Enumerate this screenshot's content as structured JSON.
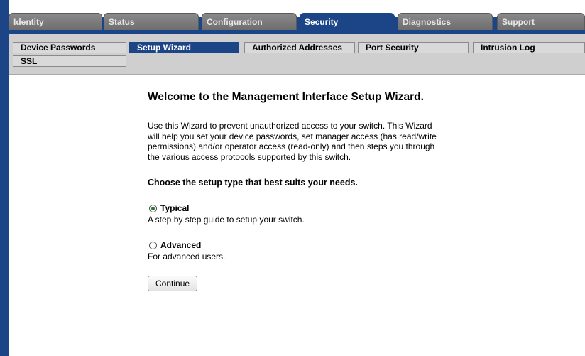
{
  "top_tabs": [
    {
      "label": "Identity",
      "active": false
    },
    {
      "label": "Status",
      "active": false
    },
    {
      "label": "Configuration",
      "active": false
    },
    {
      "label": "Security",
      "active": true
    },
    {
      "label": "Diagnostics",
      "active": false
    },
    {
      "label": "Support",
      "active": false
    }
  ],
  "sub_tabs": [
    {
      "label": "Device Passwords",
      "active": false
    },
    {
      "label": "Setup Wizard",
      "active": true
    },
    {
      "label": "Authorized Addresses",
      "active": false
    },
    {
      "label": "Port Security",
      "active": false
    },
    {
      "label": "Intrusion Log",
      "active": false
    },
    {
      "label": "SSL",
      "active": false
    }
  ],
  "main": {
    "title": "Welcome to the Management Interface Setup Wizard.",
    "description": "Use this Wizard to prevent unauthorized access to your switch. This Wizard will help you set your device passwords, set manager access (has read/write permissions) and/or operator access (read-only) and then steps you through the various access protocols supported by this switch.",
    "choose_label": "Choose the setup type that best suits your needs.",
    "options": [
      {
        "label": "Typical",
        "hint": "A step by step guide to setup your switch.",
        "checked": true
      },
      {
        "label": "Advanced",
        "hint": "For advanced users.",
        "checked": false
      }
    ],
    "continue_label": "Continue"
  },
  "colors": {
    "accent": "#1c4587",
    "tab_inactive": "#7b7b7b",
    "subnav_bg": "#cfcfcf"
  }
}
